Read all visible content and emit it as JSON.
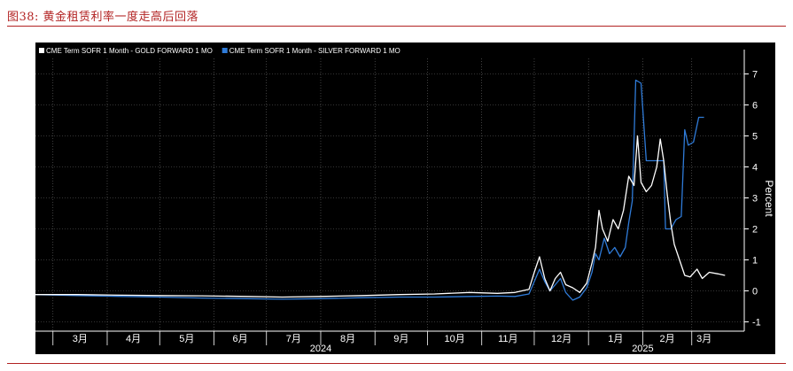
{
  "figure": {
    "title": "图38:    黄金租赁利率一度走高后回落"
  },
  "chart_data": {
    "type": "line",
    "ylabel": "Percent",
    "ylim": [
      -1.3,
      7.5
    ],
    "yticks": [
      -1,
      0,
      1,
      2,
      3,
      4,
      5,
      6,
      7
    ],
    "grid": true,
    "legend_position": "top-left",
    "x_range": [
      "2024-02-20",
      "2025-03-31"
    ],
    "month_ticks": [
      {
        "label": "3月",
        "date": "2024-03-01"
      },
      {
        "label": "4月",
        "date": "2024-04-01"
      },
      {
        "label": "5月",
        "date": "2024-05-01"
      },
      {
        "label": "6月",
        "date": "2024-06-01"
      },
      {
        "label": "7月",
        "date": "2024-07-01"
      },
      {
        "label": "8月",
        "date": "2024-08-01"
      },
      {
        "label": "9月",
        "date": "2024-09-01"
      },
      {
        "label": "10月",
        "date": "2024-10-01"
      },
      {
        "label": "11月",
        "date": "2024-11-01"
      },
      {
        "label": "12月",
        "date": "2024-12-01"
      },
      {
        "label": "1月",
        "date": "2025-01-01"
      },
      {
        "label": "2月",
        "date": "2025-02-01"
      },
      {
        "label": "3月",
        "date": "2025-03-01"
      }
    ],
    "year_labels": [
      {
        "label": "2024",
        "date": "2024-08-01"
      },
      {
        "label": "2025",
        "date": "2025-02-01"
      }
    ],
    "series": [
      {
        "name": "CME Term SOFR 1 Month - GOLD FORWARD 1 MO",
        "color": "#ffffff",
        "points": [
          [
            "2024-02-20",
            -0.12
          ],
          [
            "2024-03-15",
            -0.12
          ],
          [
            "2024-04-10",
            -0.14
          ],
          [
            "2024-05-01",
            -0.15
          ],
          [
            "2024-05-25",
            -0.16
          ],
          [
            "2024-06-20",
            -0.18
          ],
          [
            "2024-07-10",
            -0.2
          ],
          [
            "2024-08-01",
            -0.18
          ],
          [
            "2024-08-25",
            -0.15
          ],
          [
            "2024-09-15",
            -0.12
          ],
          [
            "2024-10-05",
            -0.1
          ],
          [
            "2024-10-25",
            -0.05
          ],
          [
            "2024-11-10",
            -0.08
          ],
          [
            "2024-11-20",
            -0.05
          ],
          [
            "2024-11-28",
            0.05
          ],
          [
            "2024-12-01",
            0.6
          ],
          [
            "2024-12-04",
            1.1
          ],
          [
            "2024-12-07",
            0.4
          ],
          [
            "2024-12-10",
            0.0
          ],
          [
            "2024-12-13",
            0.4
          ],
          [
            "2024-12-16",
            0.6
          ],
          [
            "2024-12-19",
            0.2
          ],
          [
            "2024-12-23",
            0.1
          ],
          [
            "2024-12-27",
            -0.05
          ],
          [
            "2024-12-31",
            0.25
          ],
          [
            "2025-01-03",
            0.9
          ],
          [
            "2025-01-05",
            1.4
          ],
          [
            "2025-01-07",
            2.6
          ],
          [
            "2025-01-09",
            2.0
          ],
          [
            "2025-01-12",
            1.6
          ],
          [
            "2025-01-15",
            2.3
          ],
          [
            "2025-01-18",
            2.0
          ],
          [
            "2025-01-21",
            2.6
          ],
          [
            "2025-01-24",
            3.7
          ],
          [
            "2025-01-27",
            3.4
          ],
          [
            "2025-01-29",
            5.0
          ],
          [
            "2025-01-31",
            3.5
          ],
          [
            "2025-02-03",
            3.2
          ],
          [
            "2025-02-06",
            3.4
          ],
          [
            "2025-02-09",
            4.0
          ],
          [
            "2025-02-11",
            4.9
          ],
          [
            "2025-02-13",
            4.2
          ],
          [
            "2025-02-15",
            3.1
          ],
          [
            "2025-02-17",
            2.2
          ],
          [
            "2025-02-19",
            1.5
          ],
          [
            "2025-02-22",
            1.0
          ],
          [
            "2025-02-25",
            0.5
          ],
          [
            "2025-02-28",
            0.45
          ],
          [
            "2025-03-04",
            0.7
          ],
          [
            "2025-03-07",
            0.4
          ],
          [
            "2025-03-11",
            0.6
          ],
          [
            "2025-03-16",
            0.55
          ],
          [
            "2025-03-20",
            0.5
          ]
        ]
      },
      {
        "name": "CME Term SOFR 1 Month - SILVER FORWARD 1 MO",
        "color": "#2f7bd8",
        "points": [
          [
            "2024-02-20",
            -0.12
          ],
          [
            "2024-03-15",
            -0.15
          ],
          [
            "2024-04-10",
            -0.18
          ],
          [
            "2024-05-01",
            -0.2
          ],
          [
            "2024-05-25",
            -0.23
          ],
          [
            "2024-06-20",
            -0.25
          ],
          [
            "2024-07-10",
            -0.27
          ],
          [
            "2024-08-01",
            -0.25
          ],
          [
            "2024-08-25",
            -0.22
          ],
          [
            "2024-09-15",
            -0.2
          ],
          [
            "2024-10-05",
            -0.2
          ],
          [
            "2024-10-25",
            -0.18
          ],
          [
            "2024-11-10",
            -0.17
          ],
          [
            "2024-11-20",
            -0.18
          ],
          [
            "2024-11-28",
            -0.1
          ],
          [
            "2024-12-01",
            0.3
          ],
          [
            "2024-12-04",
            0.7
          ],
          [
            "2024-12-07",
            0.3
          ],
          [
            "2024-12-10",
            0.0
          ],
          [
            "2024-12-13",
            0.2
          ],
          [
            "2024-12-16",
            0.4
          ],
          [
            "2024-12-19",
            -0.05
          ],
          [
            "2024-12-23",
            -0.3
          ],
          [
            "2024-12-27",
            -0.2
          ],
          [
            "2024-12-31",
            0.1
          ],
          [
            "2025-01-03",
            0.6
          ],
          [
            "2025-01-05",
            1.2
          ],
          [
            "2025-01-07",
            1.0
          ],
          [
            "2025-01-10",
            1.7
          ],
          [
            "2025-01-13",
            1.2
          ],
          [
            "2025-01-16",
            1.4
          ],
          [
            "2025-01-19",
            1.1
          ],
          [
            "2025-01-22",
            1.4
          ],
          [
            "2025-01-24",
            2.2
          ],
          [
            "2025-01-26",
            2.9
          ],
          [
            "2025-01-28",
            6.8
          ],
          [
            "2025-01-31",
            6.7
          ],
          [
            "2025-02-03",
            4.2
          ],
          [
            "2025-02-06",
            4.2
          ],
          [
            "2025-02-10",
            4.2
          ],
          [
            "2025-02-13",
            4.2
          ],
          [
            "2025-02-14",
            2.0
          ],
          [
            "2025-02-17",
            2.0
          ],
          [
            "2025-02-20",
            2.3
          ],
          [
            "2025-02-23",
            2.4
          ],
          [
            "2025-02-25",
            5.2
          ],
          [
            "2025-02-27",
            4.7
          ],
          [
            "2025-03-02",
            4.8
          ],
          [
            "2025-03-05",
            5.6
          ],
          [
            "2025-03-08",
            5.6
          ]
        ]
      }
    ]
  }
}
